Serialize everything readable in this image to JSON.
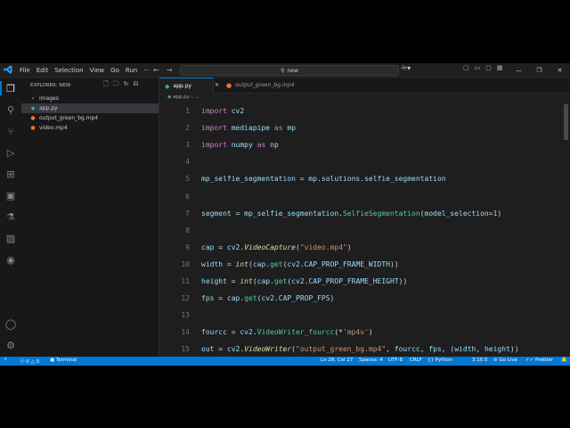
{
  "titlebar": {
    "menu": [
      "File",
      "Edit",
      "Selection",
      "View",
      "Go",
      "Run"
    ],
    "search_placeholder": "new",
    "window_controls": [
      "—",
      "❐",
      "✕"
    ]
  },
  "sidebar": {
    "header": "EXPLORER: NEW",
    "items": [
      {
        "label": "images",
        "icon": "chevron-right-icon"
      },
      {
        "label": "app.py",
        "icon": "python-file-icon",
        "selected": true
      },
      {
        "label": "output_green_bg.mp4",
        "icon": "video-file-icon"
      },
      {
        "label": "video.mp4",
        "icon": "video-file-icon"
      }
    ]
  },
  "tabs": [
    {
      "label": "app.py",
      "active": true
    },
    {
      "label": "output_green_bg.mp4",
      "active": false
    }
  ],
  "breadcrumb": {
    "file": "app.py",
    "rest": "..."
  },
  "code": {
    "line_numbers": [
      "1",
      "2",
      "3",
      "4",
      "5",
      "6",
      "7",
      "8",
      "9",
      "10",
      "11",
      "12",
      "13",
      "14",
      "15"
    ],
    "lines": [
      "import cv2",
      "import mediapipe as mp",
      "import numpy as np",
      "",
      "mp_selfie_segmentation = mp.solutions.selfie_segmentation",
      "",
      "segment = mp_selfie_segmentation.SelfieSegmentation(model_selection=1)",
      "",
      "cap = cv2.VideoCapture(\"video.mp4\")",
      "width = int(cap.get(cv2.CAP_PROP_FRAME_WIDTH))",
      "height = int(cap.get(cv2.CAP_PROP_FRAME_HEIGHT))",
      "fps = cap.get(cv2.CAP_PROP_FPS)",
      "",
      "fourcc = cv2.VideoWriter_fourcc(*'mp4v')",
      "out = cv2.VideoWriter(\"output_green_bg.mp4\", fourcc, fps, (width, height))"
    ]
  },
  "statusbar": {
    "errors": "0",
    "warnings": "0",
    "terminal": "Terminal",
    "cursor": "Ln 28, Col 27",
    "spaces": "Spaces: 4",
    "encoding": "UTF-8",
    "eol": "CRLF",
    "language": "Python",
    "version": "3.10.5",
    "golive": "Go Live",
    "prettier": "Prettier"
  },
  "colors": {
    "accent": "#0078d4",
    "keyword": "#c586c0",
    "variable": "#9cdcfe",
    "function": "#dcdcaa",
    "string": "#ce9178"
  }
}
